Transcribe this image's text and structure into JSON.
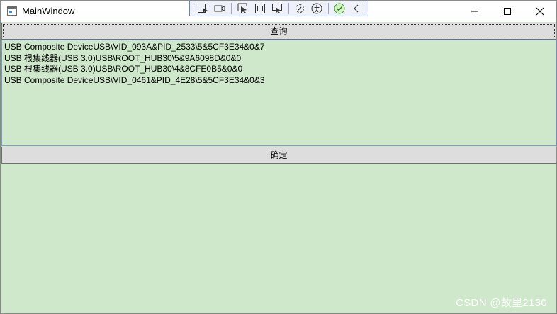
{
  "window": {
    "title": "MainWindow",
    "controls": {
      "minimize": "minimize-icon",
      "maximize": "maximize-icon",
      "close": "close-icon"
    }
  },
  "debug_toolbar": {
    "icons": [
      "select-element-icon",
      "video-icon",
      "pointer-select-icon",
      "frame-icon",
      "display-layout-icon",
      "hot-reload-icon",
      "accessibility-icon",
      "checkmark-icon",
      "chevron-left-icon"
    ]
  },
  "main": {
    "query_button": "查询",
    "list_items": [
      "USB Composite DeviceUSB\\VID_093A&PID_2533\\5&5CF3E34&0&7",
      "USB 根集线器(USB 3.0)USB\\ROOT_HUB30\\5&9A6098D&0&0",
      "USB 根集线器(USB 3.0)USB\\ROOT_HUB30\\4&8CFE0B5&0&0",
      "USB Composite DeviceUSB\\VID_0461&PID_4E28\\5&5CF3E34&0&3"
    ],
    "ok_button": "确定"
  },
  "watermark": "CSDN @故里2130",
  "colors": {
    "client_background": "#cfe8cb",
    "button_background": "#dddddd",
    "listbox_border": "#7a9cc2",
    "toolbar_background": "#eef1fa"
  }
}
